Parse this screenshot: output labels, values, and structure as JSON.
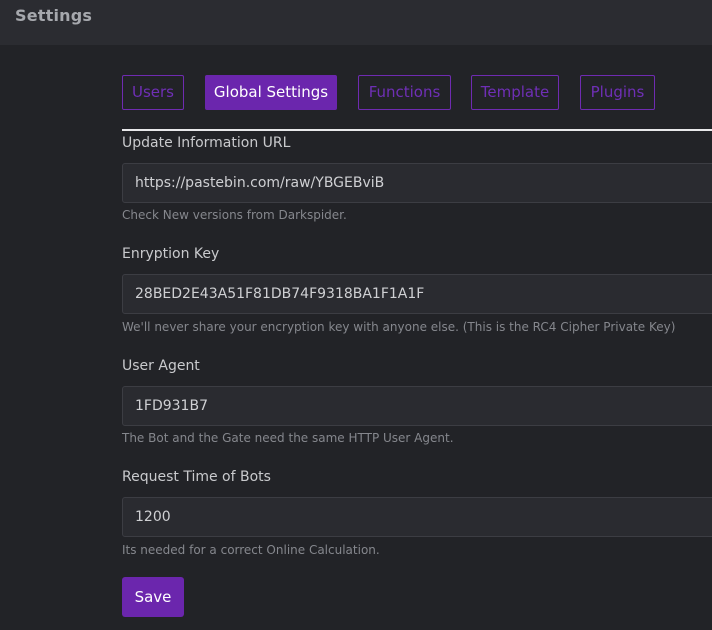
{
  "header": {
    "title": "Settings"
  },
  "tabs": [
    {
      "label": "Users"
    },
    {
      "label": "Global Settings",
      "active": true
    },
    {
      "label": "Functions"
    },
    {
      "label": "Template"
    },
    {
      "label": "Plugins"
    }
  ],
  "form": {
    "update_url": {
      "label": "Update Information URL",
      "value": "https://pastebin.com/raw/YBGEBviB",
      "help": "Check New versions from Darkspider."
    },
    "encryption_key": {
      "label": "Enryption Key",
      "value": "28BED2E43A51F81DB74F9318BA1F1A1F",
      "help": "We'll never share your encryption key with anyone else. (This is the RC4 Cipher Private Key)"
    },
    "user_agent": {
      "label": "User Agent",
      "value": "1FD931B7",
      "help": "The Bot and the Gate need the same HTTP User Agent."
    },
    "request_time": {
      "label": "Request Time of Bots",
      "value": "1200",
      "help": "Its needed for a correct Online Calculation."
    }
  },
  "actions": {
    "save_label": "Save"
  },
  "colors": {
    "background": "#222327",
    "header_background": "#2b2c31",
    "accent": "#6b26ad",
    "input_background": "#2a2b30"
  }
}
